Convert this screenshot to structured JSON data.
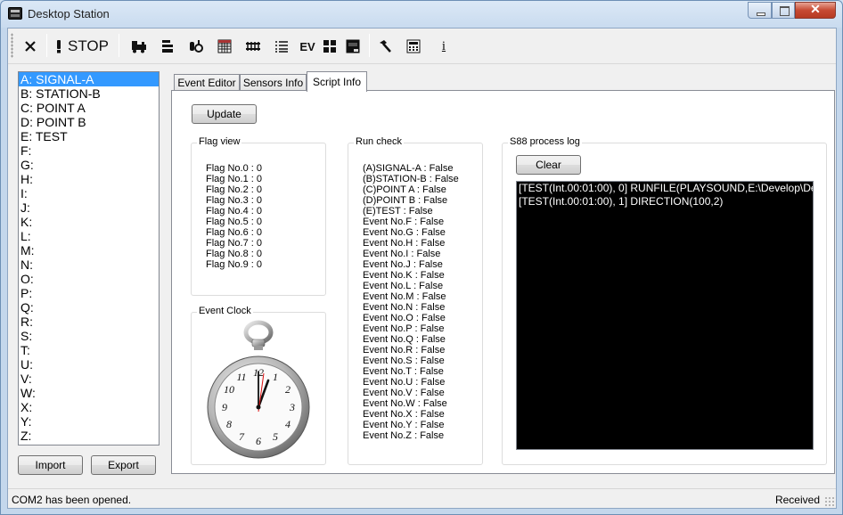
{
  "window": {
    "title": "Desktop Station"
  },
  "toolbar": {
    "stop_label": "STOP",
    "buttons": [
      "close-icon",
      "stop-icon",
      "locomotive-icon",
      "stack-icon",
      "coupling-icon",
      "grid-icon",
      "rail-icon",
      "list-icon",
      "ev-icon",
      "layout-icon",
      "s88-icon",
      "hammer-icon",
      "calculator-icon",
      "info-icon"
    ],
    "ev_text": "EV",
    "info_text": "i"
  },
  "sidebar": {
    "items": [
      "A: SIGNAL-A",
      "B: STATION-B",
      "C: POINT A",
      "D: POINT B",
      "E: TEST",
      "F:",
      "G:",
      "H:",
      "I:",
      "J:",
      "K:",
      "L:",
      "M:",
      "N:",
      "O:",
      "P:",
      "Q:",
      "R:",
      "S:",
      "T:",
      "U:",
      "V:",
      "W:",
      "X:",
      "Y:",
      "Z:"
    ],
    "selected_index": 0,
    "import_label": "Import",
    "export_label": "Export"
  },
  "tabs": [
    "Event Editor",
    "Sensors Info",
    "Script Info"
  ],
  "active_tab": "Script Info",
  "script_info": {
    "update_label": "Update",
    "flag_view": {
      "title": "Flag view",
      "lines": [
        "Flag No.0 : 0",
        "Flag No.1 : 0",
        "Flag No.2 : 0",
        "Flag No.3 : 0",
        "Flag No.4 : 0",
        "Flag No.5 : 0",
        "Flag No.6 : 0",
        "Flag No.7 : 0",
        "Flag No.8 : 0",
        "Flag No.9 : 0"
      ]
    },
    "event_clock": {
      "title": "Event Clock"
    },
    "run_check": {
      "title": "Run check",
      "lines": [
        "(A)SIGNAL-A : False",
        "(B)STATION-B : False",
        "(C)POINT A : False",
        "(D)POINT B : False",
        "(E)TEST : False",
        "Event No.F : False",
        "Event No.G : False",
        "Event No.H : False",
        "Event No.I : False",
        "Event No.J : False",
        "Event No.K : False",
        "Event No.L : False",
        "Event No.M : False",
        "Event No.N : False",
        "Event No.O : False",
        "Event No.P : False",
        "Event No.Q : False",
        "Event No.R : False",
        "Event No.S : False",
        "Event No.T : False",
        "Event No.U : False",
        "Event No.V : False",
        "Event No.W : False",
        "Event No.X : False",
        "Event No.Y : False",
        "Event No.Z : False"
      ]
    },
    "s88_log": {
      "title": "S88 process log",
      "clear_label": "Clear",
      "lines": [
        "[TEST(Int.00:01:00), 0] RUNFILE(PLAYSOUND,E:\\Develop\\De",
        "[TEST(Int.00:01:00), 1] DIRECTION(100,2)"
      ]
    }
  },
  "status": {
    "left": "COM2 has been opened.",
    "right": "Received"
  }
}
